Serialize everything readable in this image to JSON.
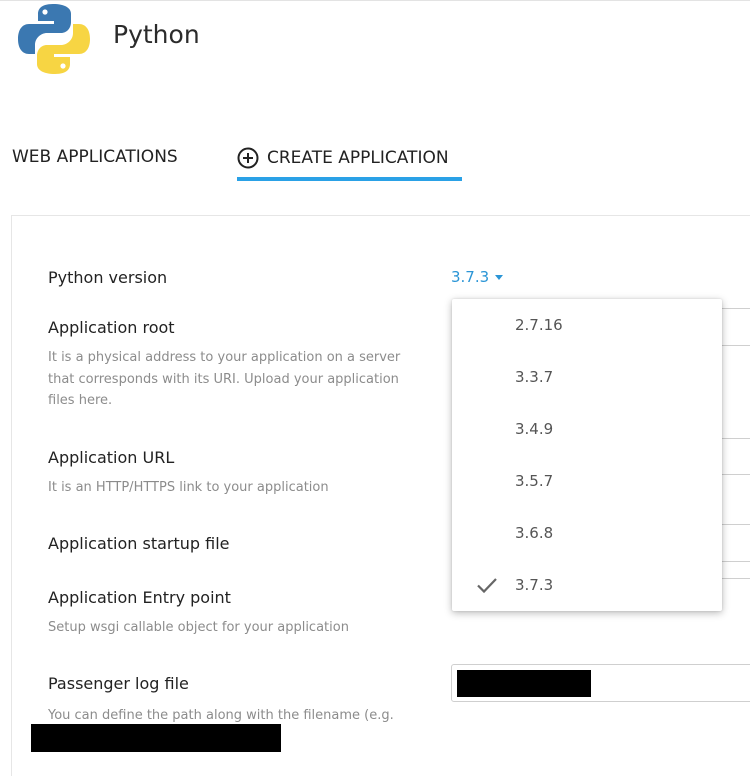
{
  "header": {
    "title": "Python"
  },
  "tabs": [
    {
      "label": "WEB APPLICATIONS",
      "active": false
    },
    {
      "label": "CREATE APPLICATION",
      "active": true,
      "icon": "add-circle-icon"
    }
  ],
  "form": {
    "python_version": {
      "label": "Python version",
      "selected": "3.7.3"
    },
    "app_root": {
      "label": "Application root",
      "description": "It is a physical address to your application on a server that corresponds with its URI. Upload your application files here."
    },
    "app_url": {
      "label": "Application URL",
      "description": "It is an HTTP/HTTPS link to your application"
    },
    "startup_file": {
      "label": "Application startup file"
    },
    "entry_point": {
      "label": "Application Entry point",
      "description": "Setup wsgi callable object for your application"
    },
    "passenger_log": {
      "label": "Passenger log file",
      "description": "You can define the path along with the filename (e.g."
    }
  },
  "dropdown": {
    "options": [
      "2.7.16",
      "3.3.7",
      "3.4.9",
      "3.5.7",
      "3.6.8",
      "3.7.3"
    ],
    "selected_index": 5
  },
  "colors": {
    "accent": "#2aa1e6",
    "link": "#2b95d6",
    "python_blue": "#3b78b1",
    "python_yellow": "#f7d543"
  }
}
